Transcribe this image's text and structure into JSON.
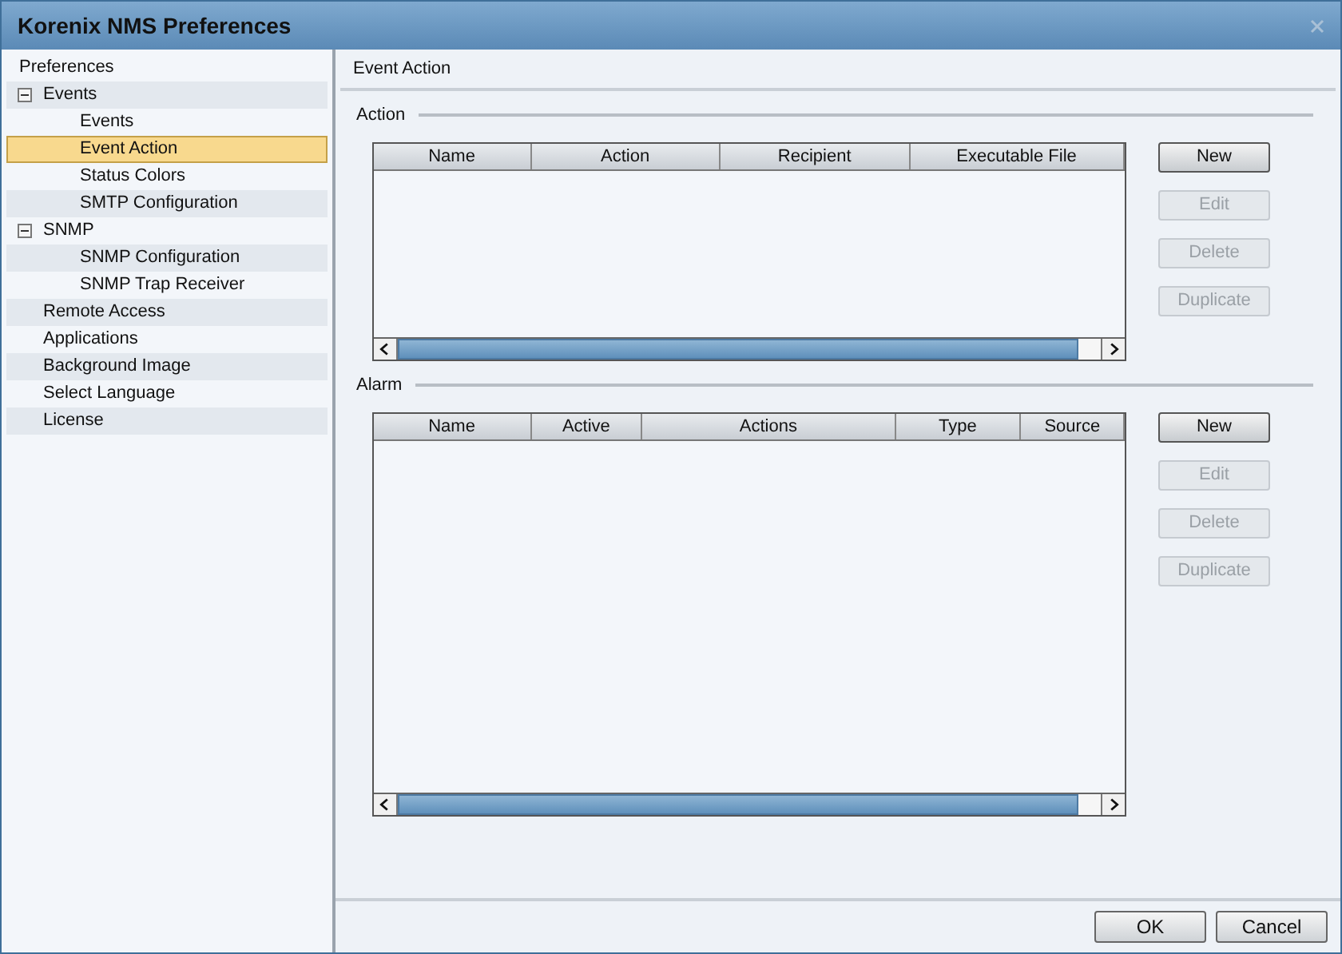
{
  "window": {
    "title": "Korenix NMS Preferences"
  },
  "sidebar": {
    "root": "Preferences",
    "items": [
      {
        "label": "Events",
        "expanded": true,
        "selected": false,
        "children": [
          {
            "label": "Events",
            "selected": false
          },
          {
            "label": "Event Action",
            "selected": true
          },
          {
            "label": "Status Colors",
            "selected": false
          },
          {
            "label": "SMTP Configuration",
            "selected": false
          }
        ]
      },
      {
        "label": "SNMP",
        "expanded": true,
        "selected": false,
        "children": [
          {
            "label": "SNMP Configuration",
            "selected": false
          },
          {
            "label": "SNMP Trap Receiver",
            "selected": false
          }
        ]
      },
      {
        "label": "Remote Access",
        "selected": false
      },
      {
        "label": "Applications",
        "selected": false
      },
      {
        "label": "Background Image",
        "selected": false
      },
      {
        "label": "Select Language",
        "selected": false
      },
      {
        "label": "License",
        "selected": false
      }
    ]
  },
  "panel": {
    "title": "Event Action",
    "sections": [
      {
        "title": "Action",
        "columns": [
          "Name",
          "Action",
          "Recipient",
          "Executable File"
        ],
        "buttons": [
          {
            "label": "New",
            "disabled": false
          },
          {
            "label": "Edit",
            "disabled": true
          },
          {
            "label": "Delete",
            "disabled": true
          },
          {
            "label": "Duplicate",
            "disabled": true
          }
        ]
      },
      {
        "title": "Alarm",
        "columns": [
          "Name",
          "Active",
          "Actions",
          "Type",
          "Source"
        ],
        "buttons": [
          {
            "label": "New",
            "disabled": false
          },
          {
            "label": "Edit",
            "disabled": true
          },
          {
            "label": "Delete",
            "disabled": true
          },
          {
            "label": "Duplicate",
            "disabled": true
          }
        ]
      }
    ]
  },
  "buttons": [
    "OK",
    "Cancel"
  ]
}
